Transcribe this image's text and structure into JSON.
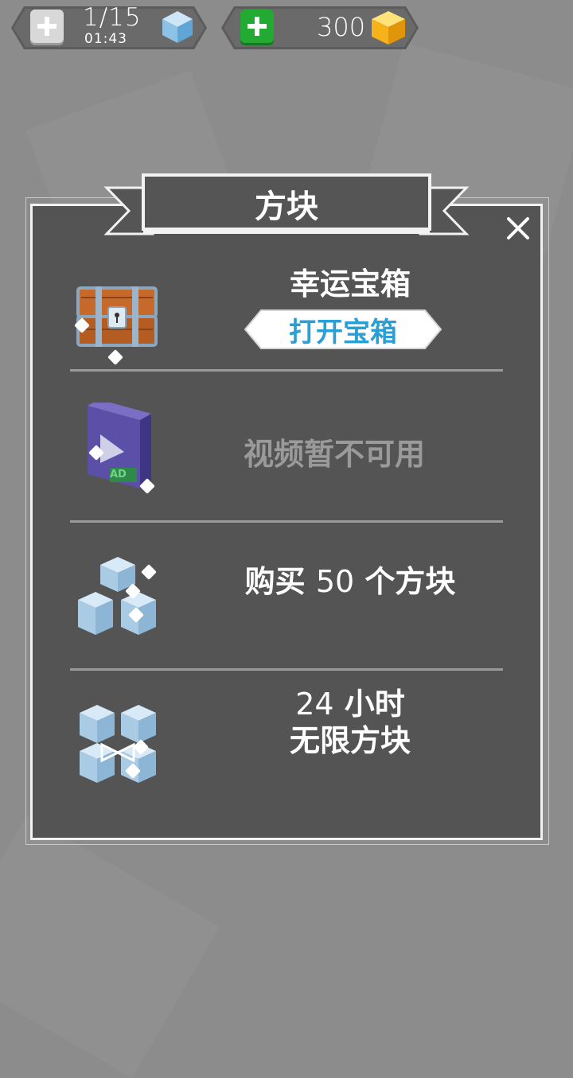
{
  "top_bar": {
    "lives_counter": "1/15",
    "timer": "01:43",
    "coins": "300"
  },
  "dialog": {
    "title": "方块",
    "rows": [
      {
        "title": "幸运宝箱",
        "button_label": "打开宝箱"
      },
      {
        "label": "视频暂不可用",
        "ad_badge": "AD"
      },
      {
        "label_prefix": "购买",
        "amount": "50",
        "label_suffix": "个方块"
      },
      {
        "hours": "24",
        "hours_unit": "小时",
        "line2": "无限方块"
      }
    ]
  },
  "colors": {
    "background": "#8c8c8c",
    "dialog_bg": "#545454",
    "button_text": "#2a9fd6",
    "add_green": "#22aa33"
  }
}
